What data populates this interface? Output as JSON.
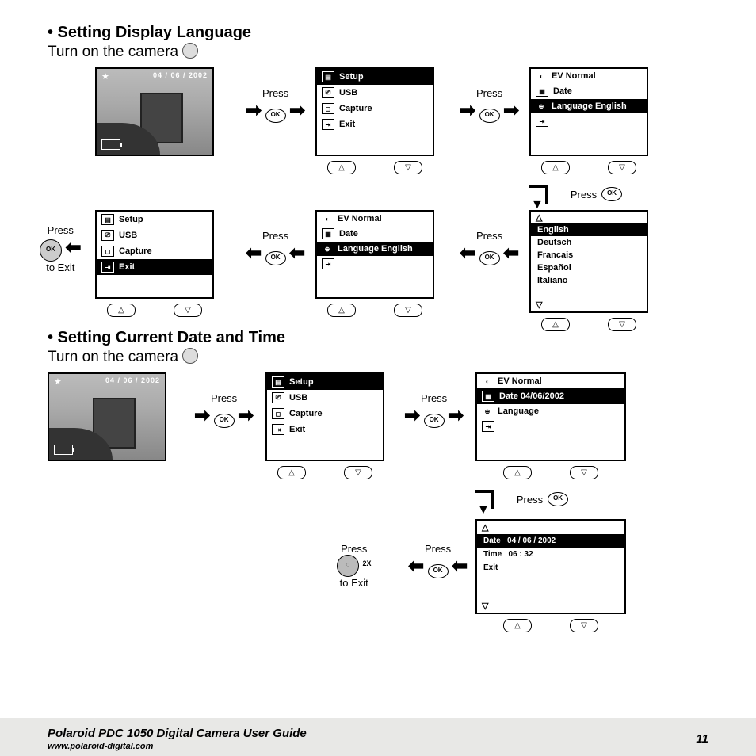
{
  "section1": {
    "title": "• Setting Display Language",
    "sub": "Turn on the camera",
    "lcd_date": "04 / 06 / 2002",
    "press": "Press",
    "ok": "OK",
    "to_exit": "to Exit",
    "menu_setup": {
      "hdr": "Setup",
      "usb": "USB",
      "capture": "Capture",
      "exit": "Exit"
    },
    "menu_lang": {
      "ev": "EV Normal",
      "date": "Date",
      "lang": "Language  English"
    },
    "languages": [
      "English",
      "Deutsch",
      "Francais",
      "Español",
      "Italiano"
    ]
  },
  "section2": {
    "title": "• Setting Current Date and Time",
    "sub": "Turn on the camera",
    "lcd_date": "04 / 06 / 2002",
    "press": "Press",
    "ok": "OK",
    "timer": "2X",
    "to_exit": "to Exit",
    "menu_setup": {
      "hdr": "Setup",
      "usb": "USB",
      "capture": "Capture",
      "exit": "Exit"
    },
    "menu_date": {
      "ev": "EV Normal",
      "date": "Date  04/06/2002",
      "lang": "Language"
    },
    "date_detail": {
      "date_lbl": "Date",
      "date_val": "04 / 06 / 2002",
      "time_lbl": "Time",
      "time_val": "06 : 32",
      "exit": "Exit"
    }
  },
  "nav": {
    "up": "△",
    "down": "▽"
  },
  "footer": {
    "title": "Polaroid PDC 1050 Digital Camera User Guide",
    "url": "www.polaroid-digital.com",
    "page": "11"
  }
}
